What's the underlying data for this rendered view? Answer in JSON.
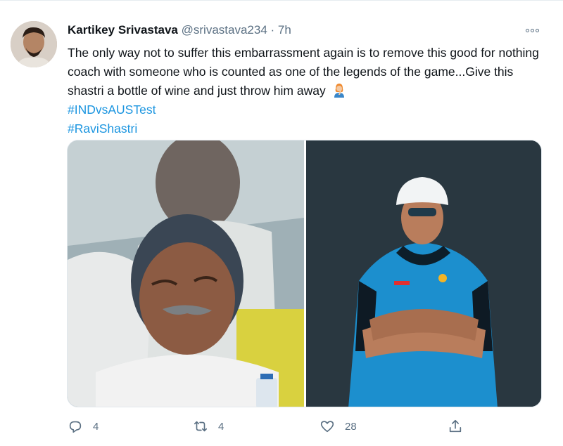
{
  "tweet": {
    "author_name": "Kartikey Srivastava",
    "author_handle": "@srivastava234",
    "separator": "·",
    "time": "7h",
    "text": "The only way not to suffer this embarrassment again is to remove this good for nothing coach with someone who is counted as one of the legends of the game...Give this shastri a bottle of wine and just throw him away",
    "emoji": "person-facepalming-emoji",
    "hashtags": [
      "#INDvsAUSTest",
      "#RaviShastri"
    ],
    "media": [
      "sleeping-man-photo",
      "coach-in-cap-and-jacket-photo"
    ]
  },
  "actions": {
    "reply_count": "4",
    "retweet_count": "4",
    "like_count": "28"
  },
  "icons": {
    "more": "more-options-icon",
    "reply": "reply-icon",
    "retweet": "retweet-icon",
    "like": "heart-icon",
    "share": "share-icon"
  },
  "colors": {
    "text": "#0f1419",
    "secondary": "#5b7083",
    "link": "#1b95e0",
    "jacket": "#1c8fce"
  }
}
